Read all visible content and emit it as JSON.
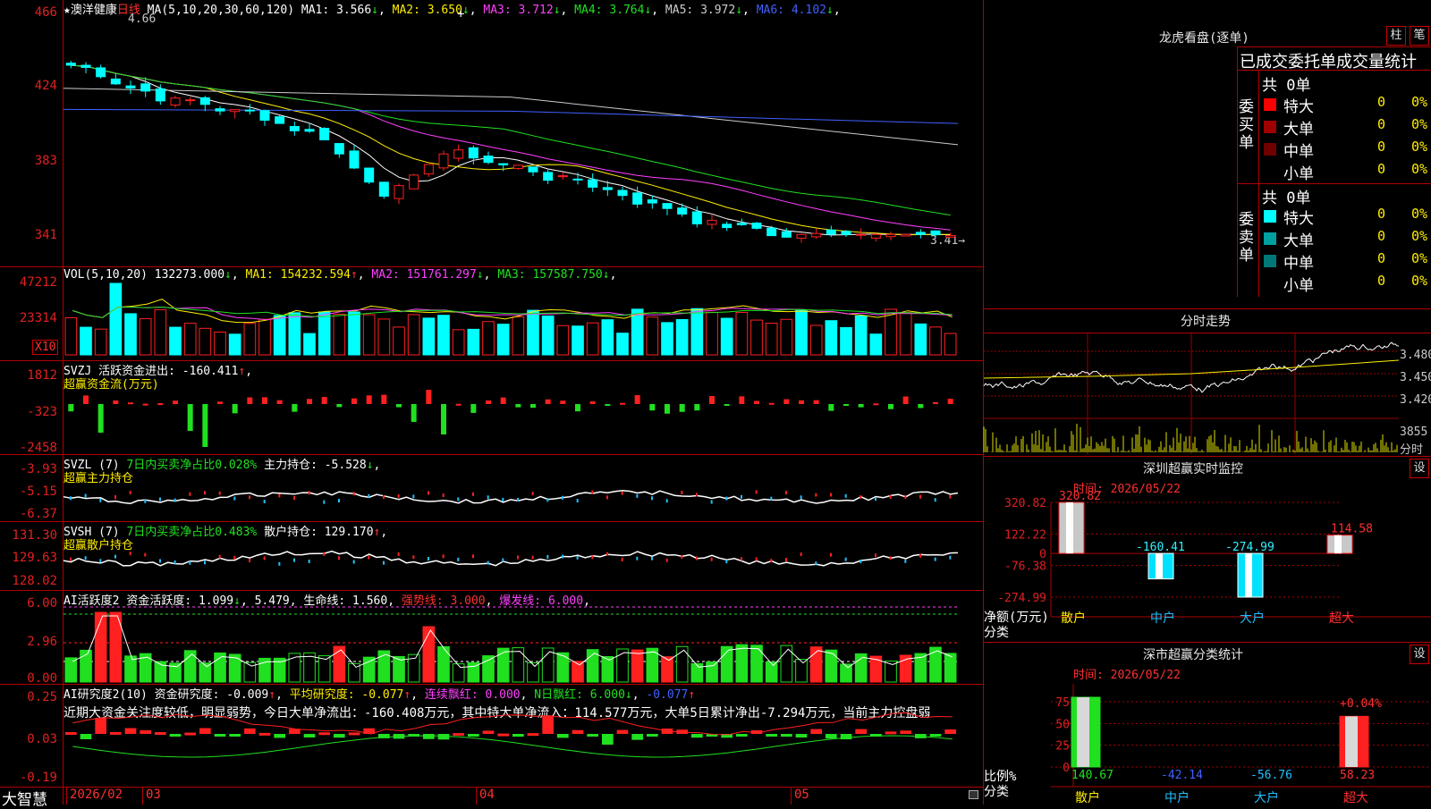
{
  "kline": {
    "title": "★澳洋健康",
    "period": "日线",
    "ma_label": "MA(5,10,20,30,60,120)",
    "ma": [
      {
        "label": "MA1:",
        "value": "3.566",
        "arrow": "↓",
        "color": "#ffffff"
      },
      {
        "label": "MA2:",
        "value": "3.650",
        "arrow": "↓",
        "color": "#ffee00"
      },
      {
        "label": "MA3:",
        "value": "3.712",
        "arrow": "↓",
        "color": "#ff40ff"
      },
      {
        "label": "MA4:",
        "value": "3.764",
        "arrow": "↓",
        "color": "#20e020"
      },
      {
        "label": "MA5:",
        "value": "3.972",
        "arrow": "↓",
        "color": "#cccccc"
      },
      {
        "label": "MA6:",
        "value": "4.102",
        "arrow": "↓",
        "color": "#4060ff"
      }
    ],
    "y_ticks": [
      "466",
      "424",
      "383",
      "341"
    ],
    "high_mark": "4.66",
    "low_mark": "3.41→",
    "cursor_glyph": "+"
  },
  "vol": {
    "title": "VOL(5,10,20)",
    "value": "132273.000",
    "arrow": "↓",
    "ma": [
      {
        "label": "MA1:",
        "value": "154232.594",
        "arrow": "↑",
        "color": "#ffee00"
      },
      {
        "label": "MA2:",
        "value": "151761.297",
        "arrow": "↓",
        "color": "#ff40ff"
      },
      {
        "label": "MA3:",
        "value": "157587.750",
        "arrow": "↓",
        "color": "#20e020"
      }
    ],
    "y_ticks": [
      "47212",
      "23314"
    ],
    "unit": "X10"
  },
  "svzj": {
    "title": "SVZJ  活跃资金进出:",
    "value": "-160.411",
    "arrow": "↑",
    "subtitle": "超赢资金流(万元)",
    "y_ticks": [
      "1812",
      "-323",
      "-2458"
    ]
  },
  "svzl": {
    "title": "SVZL (7)",
    "green_text": "7日内买卖净占比0.028%",
    "label2": "主力持仓:",
    "value2": "-5.528",
    "arrow": "↓",
    "subtitle": "超赢主力持仓",
    "y_ticks": [
      "-3.93",
      "-5.15",
      "-6.37"
    ]
  },
  "svsh": {
    "title": "SVSH (7)",
    "green_text": "7日内买卖净占比0.483%",
    "label2": "散户持仓:",
    "value2": "129.170",
    "arrow": "↑",
    "subtitle": "超赢散户持仓",
    "y_ticks": [
      "131.30",
      "129.63",
      "128.02"
    ]
  },
  "ai_active": {
    "title": "AI活跃度2",
    "label": "资金活跃度:",
    "v1": "1.099",
    "a1": "↓",
    "v2": "5.479",
    "life_label": "生命线:",
    "life": "1.560",
    "strong": "强势线: 3.000",
    "burst": "爆发线: 6.000",
    "y_ticks": [
      "6.00",
      "2.96",
      "0.00"
    ]
  },
  "ai_research": {
    "title": "AI研究度2(10)",
    "label": "资金研究度:",
    "v1": "-0.009",
    "a1": "↑",
    "avg": "平均研究度: -0.077",
    "a2": "↑",
    "cont": "连续飘红: 0.000",
    "nday": "N日飘红: 6.000",
    "a3": "↓",
    "v4": "-0.077",
    "a4": "↑",
    "comment": "近期大资金关注度较低，明显弱势，今日大单净流出：-160.408万元，其中特大单净流入：114.577万元，大单5日累计净出-7.294万元，当前主力控盘弱",
    "y_ticks": [
      "0.25",
      "0.03",
      "-0.19"
    ]
  },
  "date_axis": {
    "brand": "大智慧",
    "labels": [
      "2026/02",
      "03",
      "04",
      "05"
    ]
  },
  "dragon": {
    "title": "龙虎看盘(逐单)",
    "btn_bar": "柱",
    "btn_pen": "笔",
    "header": "已成交委托单成交量统计",
    "buy_label": "委买单",
    "sell_label": "委卖单",
    "buy_total": "共 0单",
    "sell_total": "共 0单",
    "buy_rows": [
      {
        "name": "特大",
        "count": "0",
        "pct": "0%",
        "color": "#ff0000"
      },
      {
        "name": "大单",
        "count": "0",
        "pct": "0%",
        "color": "#a00000"
      },
      {
        "name": "中单",
        "count": "0",
        "pct": "0%",
        "color": "#700000"
      },
      {
        "name": "小单",
        "count": "0",
        "pct": "0%",
        "color": "#000000"
      }
    ],
    "sell_rows": [
      {
        "name": "特大",
        "count": "0",
        "pct": "0%",
        "color": "#00ffff"
      },
      {
        "name": "大单",
        "count": "0",
        "pct": "0%",
        "color": "#00a0a0"
      },
      {
        "name": "中单",
        "count": "0",
        "pct": "0%",
        "color": "#007878"
      },
      {
        "name": "小单",
        "count": "0",
        "pct": "0%",
        "color": "#000000"
      }
    ]
  },
  "intraday": {
    "title": "分时走势",
    "y_ticks": [
      "3.480",
      "3.450",
      "3.420"
    ],
    "vol_tick": "3855",
    "vol_unit": "分时"
  },
  "sz_monitor": {
    "title": "深圳超赢实时监控",
    "setting": "设",
    "time": "时间: 2026/05/22",
    "y_ticks": [
      "320.82",
      "122.22",
      "0",
      "-76.38",
      "-274.99"
    ],
    "ylabel": "净额(万元)",
    "xlabel": "分类",
    "chart_data": {
      "type": "bar",
      "categories": [
        "散户",
        "中户",
        "大户",
        "超大"
      ],
      "values": [
        320.82,
        -160.41,
        -274.99,
        114.58
      ],
      "value_labels": [
        "320.82",
        "-160.41",
        "-274.99",
        "114.58"
      ],
      "ylabel": "净额(万元)",
      "xlabel": "分类",
      "ylim": [
        -274.99,
        320.82
      ]
    }
  },
  "sz_class": {
    "title": "深市超赢分类统计",
    "setting": "设",
    "time": "时间: 2026/05/22",
    "y_ticks": [
      "75",
      "50",
      "25",
      "0"
    ],
    "ylabel": "比例%",
    "xlabel": "分类",
    "top_label": "+0.04%",
    "chart_data": {
      "type": "bar",
      "categories": [
        "散户",
        "中户",
        "大户",
        "超大"
      ],
      "values": [
        140.67,
        -42.14,
        -56.76,
        58.23
      ],
      "value_labels": [
        "140.67",
        "-42.14",
        "-56.76",
        "58.23"
      ],
      "ylabel": "比例%",
      "xlabel": "分类",
      "ylim": [
        0,
        75
      ]
    }
  }
}
